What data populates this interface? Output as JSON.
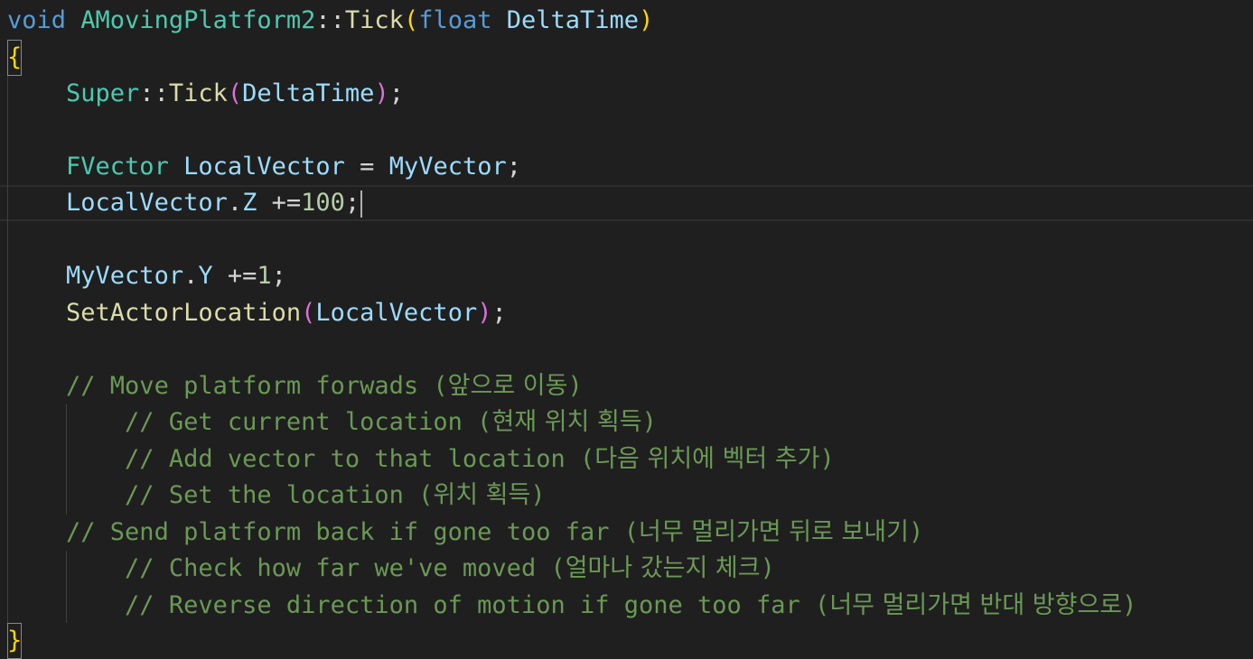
{
  "editor": {
    "language": "cpp",
    "theme_colors": {
      "background": "#1f1f1f",
      "keyword": "#569cd6",
      "type": "#4ec9b0",
      "function": "#dcdcaa",
      "variable": "#9cdcfe",
      "number": "#b5cea8",
      "comment": "#6a9955",
      "bracket_level1": "#ffd700",
      "bracket_level2": "#da70d6"
    },
    "lines": {
      "l1": {
        "void_kw": "void",
        "class_name": "AMovingPlatform2",
        "scope_op": "::",
        "func_name": "Tick",
        "open_paren": "(",
        "float_kw": "float",
        "param_name": "DeltaTime",
        "close_paren": ")"
      },
      "l2": {
        "open_brace": "{"
      },
      "l3": {
        "super_name": "Super",
        "scope_op": "::",
        "func_name": "Tick",
        "open_paren": "(",
        "arg": "DeltaTime",
        "close_paren": ")",
        "semicolon": ";"
      },
      "l5": {
        "type_name": "FVector",
        "var_name": "LocalVector",
        "assign": " = ",
        "value": "MyVector",
        "semicolon": ";"
      },
      "l6": {
        "var_name": "LocalVector",
        "dot": ".",
        "member": "Z",
        "op": " +=",
        "number": "100",
        "semicolon": ";"
      },
      "l8": {
        "var_name": "MyVector",
        "dot": ".",
        "member": "Y",
        "op": " +=",
        "number": "1",
        "semicolon": ";"
      },
      "l9": {
        "func_name": "SetActorLocation",
        "open_paren": "(",
        "arg": "LocalVector",
        "close_paren": ")",
        "semicolon": ";"
      },
      "l11": {
        "comment": "// Move platform forwads (",
        "korean": "앞으로 이동",
        "close": ")"
      },
      "l12": {
        "comment": "// Get current location (",
        "korean": "현재 위치 획득",
        "close": ")"
      },
      "l13": {
        "comment": "// Add vector to that location (",
        "korean": "다음 위치에 벡터 추가",
        "close": ")"
      },
      "l14": {
        "comment": "// Set the location (",
        "korean": "위치 획득",
        "close": ")"
      },
      "l15": {
        "comment": "// Send platform back if gone too far (",
        "korean": "너무 멀리가면 뒤로 보내기",
        "close": ")"
      },
      "l16": {
        "comment": "// Check how far we've moved (",
        "korean": "얼마나 갔는지 체크",
        "close": ")"
      },
      "l17": {
        "comment": "// Reverse direction of motion if gone too far (",
        "korean": "너무 멀리가면 반대 방향으로",
        "close": ")"
      },
      "l18": {
        "close_brace": "}"
      }
    }
  }
}
